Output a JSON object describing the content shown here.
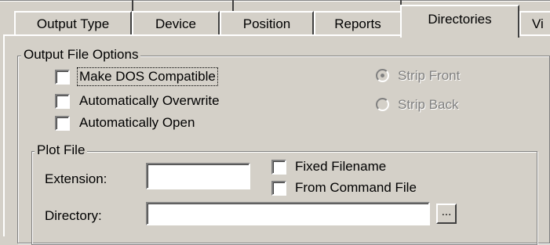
{
  "tabs": [
    {
      "label": "Output Type",
      "active": false
    },
    {
      "label": "Device",
      "active": false
    },
    {
      "label": "Position",
      "active": false
    },
    {
      "label": "Reports",
      "active": false
    },
    {
      "label": "Directories",
      "active": true
    },
    {
      "label": "Vi",
      "active": false
    }
  ],
  "output_file_options": {
    "title": "Output File Options",
    "checkboxes": [
      {
        "label": "Make DOS Compatible",
        "checked": false,
        "focused": true
      },
      {
        "label": "Automatically Overwrite",
        "checked": false
      },
      {
        "label": "Automatically Open",
        "checked": false
      }
    ],
    "radios": [
      {
        "label": "Strip Front",
        "selected": true,
        "enabled": false
      },
      {
        "label": "Strip Back",
        "selected": false,
        "enabled": false
      }
    ]
  },
  "plot_file": {
    "title": "Plot File",
    "extension_label": "Extension:",
    "extension_value": "",
    "fixed_filename_label": "Fixed Filename",
    "from_command_file_label": "From Command File",
    "directory_label": "Directory:",
    "directory_value": "",
    "browse_label": "..."
  },
  "colors": {
    "face": "#d4d0c8",
    "highlight": "#ffffff",
    "shadow": "#808080",
    "dark_shadow": "#404040",
    "disabled_text": "#808080"
  }
}
